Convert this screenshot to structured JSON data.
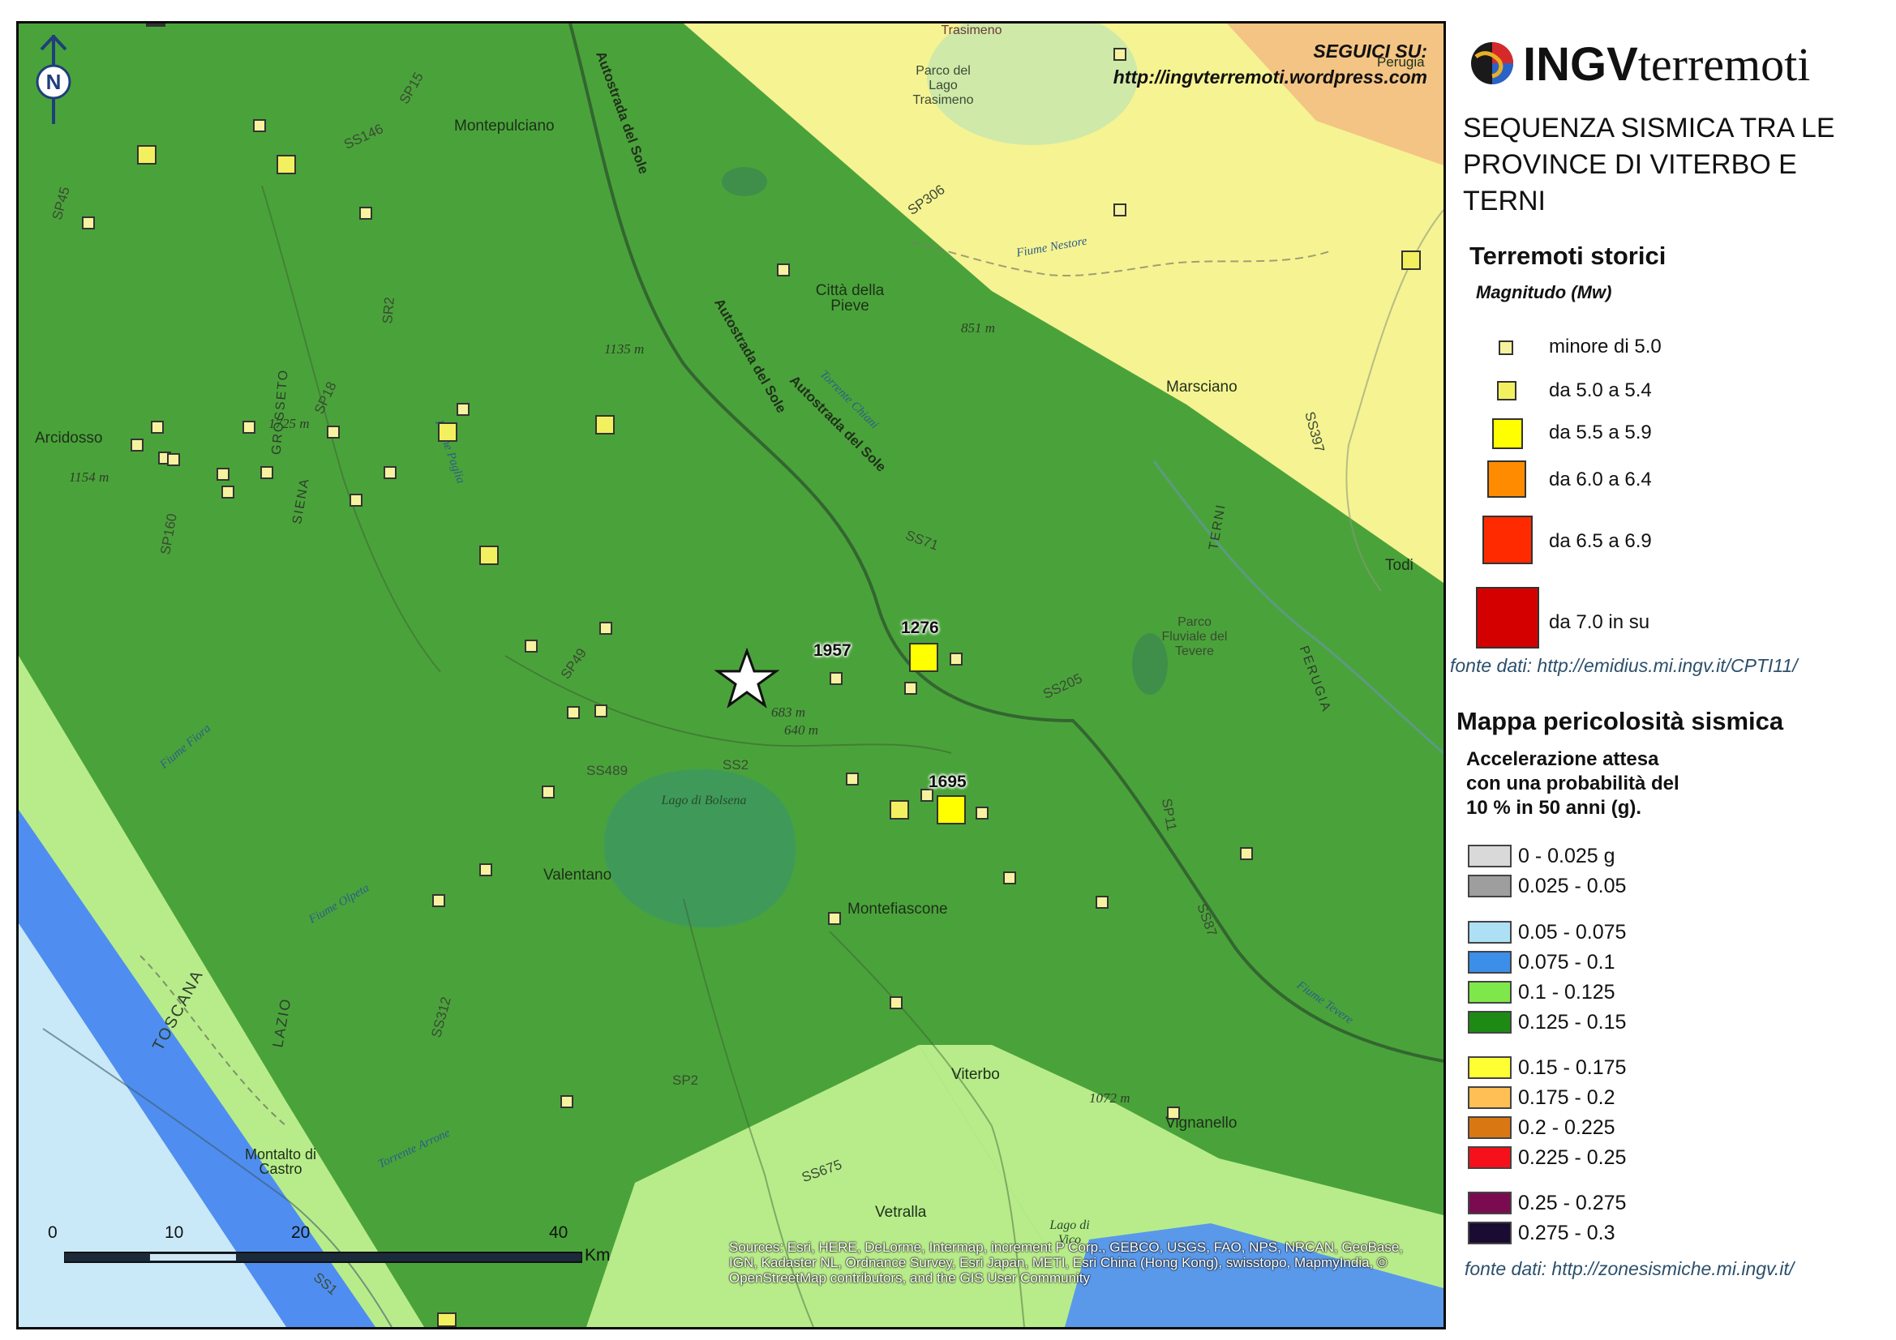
{
  "header": {
    "follow_label": "SEGUICI SU:",
    "follow_url": "http://ingvterremoti.wordpress.com"
  },
  "logo": {
    "brand_bold": "INGV",
    "brand_light": "terremoti"
  },
  "title": "SEQUENZA SISMICA TRA LE PROVINCE DI VITERBO E TERNI",
  "historical": {
    "heading": "Terremoti storici",
    "subheading": "Magnitudo (Mw)",
    "classes": [
      {
        "label": "minore di 5.0",
        "color": "#f7f2a0"
      },
      {
        "label": "da 5.0 a 5.4",
        "color": "#f3f060"
      },
      {
        "label": "da 5.5 a 5.9",
        "color": "#ffff00"
      },
      {
        "label": "da 6.0 a 6.4",
        "color": "#ff8c00"
      },
      {
        "label": "da 6.5 a 6.9",
        "color": "#ff2a00"
      },
      {
        "label": "da 7.0 in su",
        "color": "#d40000"
      }
    ],
    "source": "fonte dati: http://emidius.mi.ingv.it/CPTI11/"
  },
  "hazard": {
    "heading": "Mappa pericolosità sismica",
    "subheading_lines": [
      "Accelerazione attesa",
      "con una probabilità del",
      "10 % in 50 anni (g)."
    ],
    "classes": [
      {
        "label": "0 - 0.025 g",
        "color": "#d9d9d9"
      },
      {
        "label": "0.025 - 0.05",
        "color": "#9e9e9e"
      },
      {
        "label": "0.05 - 0.075",
        "color": "#aee0f5"
      },
      {
        "label": "0.075 - 0.1",
        "color": "#3b8fe8"
      },
      {
        "label": "0.1 - 0.125",
        "color": "#7ee84a"
      },
      {
        "label": "0.125 - 0.15",
        "color": "#1d8a13"
      },
      {
        "label": "0.15 - 0.175",
        "color": "#ffff33"
      },
      {
        "label": "0.175 - 0.2",
        "color": "#ffbf55"
      },
      {
        "label": "0.2 - 0.225",
        "color": "#d97712"
      },
      {
        "label": "0.225 - 0.25",
        "color": "#f5101a"
      },
      {
        "label": "0.25 - 0.275",
        "color": "#7a0b50"
      },
      {
        "label": "0.275 - 0.3",
        "color": "#1a0b33"
      }
    ],
    "source": "fonte dati: http://zonesismiche.mi.ingv.it/"
  },
  "map": {
    "north_label": "N",
    "towns": [
      "Montepulciano",
      "Città della Pieve",
      "Arcidosso",
      "Marsciano",
      "Todi",
      "Valentano",
      "Montefiascone",
      "Viterbo",
      "Vignanello",
      "Vetralla",
      "Montalto di Castro",
      "Perugia"
    ],
    "regions": [
      "TOSCANA",
      "LAZIO",
      "SIENA",
      "GROSSETO",
      "TERNI",
      "PERUGIA"
    ],
    "roads": [
      "SS146",
      "SP15",
      "SP45",
      "SR2",
      "SP18",
      "SP160",
      "SP49",
      "SS489",
      "SS2",
      "SS71",
      "SS205",
      "SP11",
      "SS87",
      "SS312",
      "SP2",
      "SS675",
      "SS1",
      "SP306",
      "SS397"
    ],
    "motorway": "Autostrada del Sole",
    "elevations": [
      "1135 m",
      "1725 m",
      "1154 m",
      "851 m",
      "683 m",
      "640 m",
      "1072 m"
    ],
    "rivers": [
      "Fiume Nestore",
      "Torrente Chiani",
      "Fiume Paglia",
      "Fiume Fiora",
      "Fiume Olpeta",
      "Torrente Arrone",
      "Fiume Tevere"
    ],
    "lakes": [
      "Lago di Bolsena",
      "Parco del Lago Trasimeno",
      "Trasimeno",
      "Parco Fluviale del Tevere",
      "Lago di Vico"
    ],
    "year_labels": [
      "1957",
      "1276",
      "1695"
    ],
    "scale": {
      "ticks": [
        "0",
        "10",
        "20",
        "40"
      ],
      "unit": "Km"
    },
    "credits": "Sources: Esri, HERE, DeLorme, Intermap, increment P Corp., GEBCO, USGS, FAO, NPS, NRCAN, GeoBase, IGN, Kadaster NL, Ordnance Survey, Esri Japan, METI, Esri China (Hong Kong), swisstopo, MapmyIndia, © OpenStreetMap contributors, and the GIS User Community"
  }
}
